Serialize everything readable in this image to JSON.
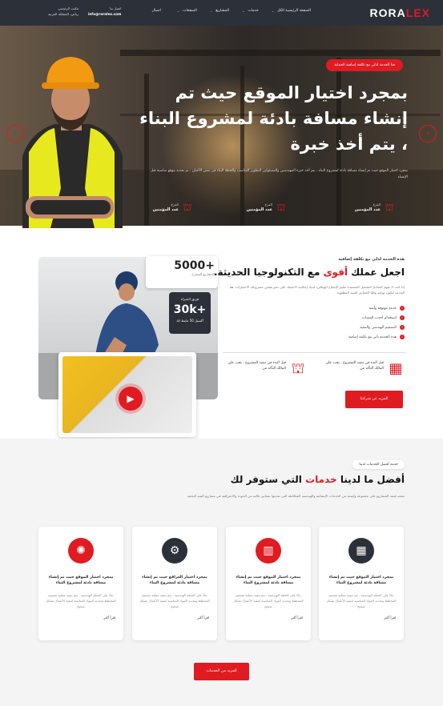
{
  "header": {
    "logo_main": "RORA",
    "logo_accent": "LEX",
    "nav": [
      "الصفحة الرئيسية الكل",
      "خدمات",
      "المشاريع",
      "الصفحات",
      "اتصال"
    ],
    "contact": {
      "l1": "مكتب الرئيسي",
      "l2": "رياض، المملكة العربية",
      "l3": "اتصل بنا",
      "email": "info@roralex.com"
    }
  },
  "hero": {
    "badge": "هنا الخدمة لذلي مع تكلفة إضافية الحماية",
    "title": "بمجرد اختيار الموقع حيث تم إنشاء مسافة بادئة لمشروع البناء ، يتم أخذ خبرة",
    "desc": "بمجرد اختيار الموقع حيث تم إنشاء مسافة بادئة لمشروع البناء ، يتم أخذ خبرة المهندسين والمسئولين التطوير المناسب والخطة البناء في بعض الأحيان ، تم تحديد موقع مناسبة قبل الإنشاء",
    "stats": [
      {
        "b": "الفرع",
        "t": "عدد المؤمنين"
      },
      {
        "b": "الفرع",
        "t": "عدد المؤمنين"
      },
      {
        "b": "الفرع",
        "t": "عدد المؤمنين"
      }
    ]
  },
  "about": {
    "stat_num": "5000+",
    "stat_lbl": "المشاريع المنجزة",
    "dark_a": "فريق الخبراء",
    "dark_b": "30k+",
    "dark_c": "أكسيل 50 ماينط لك",
    "sub": "هذه الخدمة لذلي مع تكلفة إضافية",
    "title_pre": "اجعل عملك",
    "title_red": "أقوى",
    "title_post": "مع التكنولوجيا الحديثة.",
    "desc": "إذا كنت لا تفهم المبادئ التشغيل المعتمدة تعليم الإصلاح الهيكلي، لديك إمكانية الاعتماد على نحو يضمن مشروعك الاختبارات. هنا الخدمة لتكون نوعية وفقًا للمعايير الفنية المطلوبة",
    "checks": [
      "خدمة موثوقة وآمنة",
      "استخدام أحدث المعدات",
      "التصميم الهندسي والتنفيذ",
      "هذه الخدمة تأتي مع تكلفة إضافية"
    ],
    "feat1": "قبل البدء في تنفيذ المشروع ، يجب علي المالك التأكد من",
    "feat2": "قبل البدء في تنفيذ المشروع ، يجب علي المالك التأكد من",
    "btn": "المزيد عن شركتنا"
  },
  "services": {
    "pill": "خدمة أفضل الخدمات لدينا",
    "title_pre": "أفضل ما لدينا",
    "title_red": "خدمات",
    "title_post": "التي ستوفر لك",
    "desc": "تعتمد قيمة المشاريع على مجموعة واسعة من الخدمات الإنشائية والهندسية المتكاملة التي نقدمها بمعايير عالية من الجودة والاحترافية في مشاريع البنية التحتية",
    "cards": [
      {
        "t": "بمجرد اختيار الموقع حيث تم إنشاء مسافة بادئة لمشروع البناء",
        "d": "بناءً على الخطة الهندسية ، يتم تنفيذ عملية تصميم المخطط وتحديد المواد المناسبة لتنفيذ الأعمال بشكل صحيح",
        "m": "اقرأ أكثر"
      },
      {
        "t": "بمجرد اختيار الموقع حيث تم إنشاء مسافة بادئة لمشروع البناء",
        "d": "بناءً على الخطة الهندسية ، يتم تنفيذ عملية تصميم المخطط وتحديد المواد المناسبة لتنفيذ الأعمال بشكل صحيح",
        "m": "اقرأ أكثر"
      },
      {
        "t": "بمجرد اختيار العراقع حيث تم إنشاء مسافة بادئة لمشروع البناء",
        "d": "بناءً على الخطة الهندسية ، يتم تنفيذ عملية تصميم المخطط وتحديد المواد المناسبة لتنفيذ الأعمال بشكل صحيح",
        "m": "اقرأ أكثر"
      },
      {
        "t": "بمجرد اختيار الموقع حيث تم إنشاء مسافة بادئة لمشروع البناء",
        "d": "بناءً على الخطة الهندسية ، يتم تنفيذ عملية تصميم المخطط وتحديد المواد المناسبة لتنفيذ الأعمال بشكل صحيح",
        "m": "اقرأ أكثر"
      }
    ],
    "btn": "المزيد من الخدمات"
  },
  "colors": {
    "accent": "#e01b22",
    "dark": "#2c3038"
  },
  "icons": [
    "arrow-left-icon",
    "arrow-right-icon",
    "play-icon",
    "check-icon",
    "building-icon",
    "crane-icon",
    "service-icon"
  ]
}
